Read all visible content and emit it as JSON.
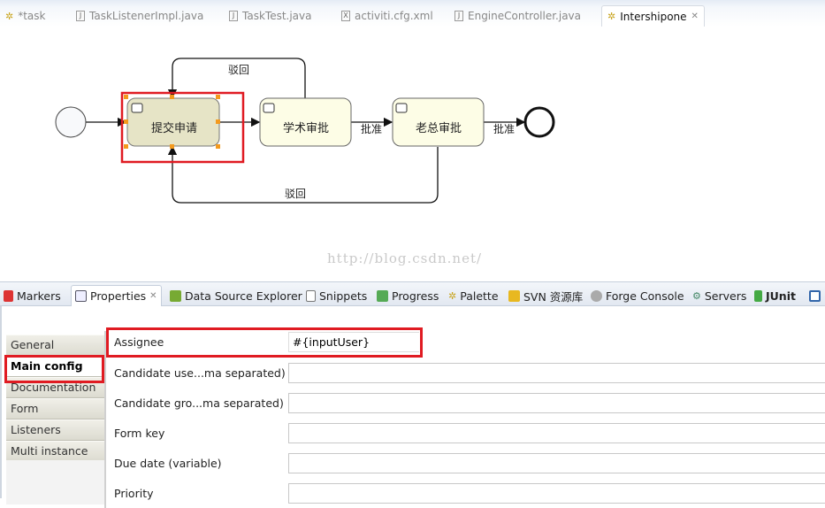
{
  "editor_tabs": [
    {
      "label": "*task",
      "icon": "activiti-diagram-icon"
    },
    {
      "label": "TaskListenerImpl.java",
      "icon": "java-file-icon"
    },
    {
      "label": "TaskTest.java",
      "icon": "java-file-icon"
    },
    {
      "label": "activiti.cfg.xml",
      "icon": "xml-file-icon"
    },
    {
      "label": "EngineController.java",
      "icon": "java-file-icon"
    },
    {
      "label": "Intershipone",
      "icon": "activiti-diagram-icon",
      "active": true
    }
  ],
  "diagram": {
    "tasks": [
      "提交申请",
      "学术审批",
      "老总审批"
    ],
    "flows": {
      "reject_top": "驳回",
      "reject_bottom": "驳回",
      "approve1": "批准",
      "approve2": "批准"
    },
    "selected_task": "提交申请"
  },
  "watermark": "http://blog.csdn.net/",
  "panel_tabs": [
    {
      "label": "Markers",
      "icon": "markers-icon"
    },
    {
      "label": "Properties",
      "icon": "properties-icon",
      "active": true
    },
    {
      "label": "Data Source Explorer",
      "icon": "data-source-icon"
    },
    {
      "label": "Snippets",
      "icon": "snippets-icon"
    },
    {
      "label": "Progress",
      "icon": "progress-icon"
    },
    {
      "label": "Palette",
      "icon": "palette-icon"
    },
    {
      "label": "SVN 资源库",
      "icon": "svn-icon"
    },
    {
      "label": "Forge Console",
      "icon": "forge-icon"
    },
    {
      "label": "Servers",
      "icon": "servers-icon"
    },
    {
      "label": "JUnit",
      "icon": "junit-icon"
    }
  ],
  "properties": {
    "side_tabs": [
      "General",
      "Main config",
      "Documentation",
      "Form",
      "Listeners",
      "Multi instance"
    ],
    "selected_side_tab": "Main config",
    "fields": [
      {
        "label": "Assignee",
        "value": "#{inputUser}"
      },
      {
        "label": "Candidate use...ma separated)",
        "value": ""
      },
      {
        "label": "Candidate gro...ma separated)",
        "value": ""
      },
      {
        "label": "Form key",
        "value": ""
      },
      {
        "label": "Due date (variable)",
        "value": ""
      },
      {
        "label": "Priority",
        "value": ""
      }
    ]
  },
  "colors": {
    "highlight": "#e01b22",
    "task_fill": "#fdfde6",
    "selected_task_fill": "#e6e4c6",
    "handle": "#f39a1e"
  }
}
